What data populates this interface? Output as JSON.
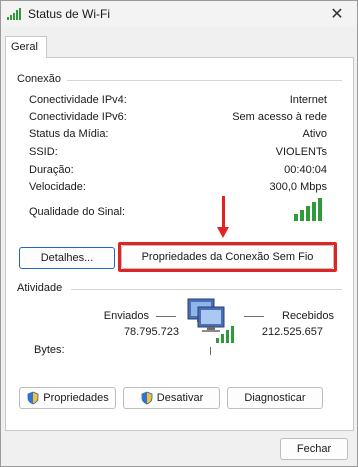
{
  "window": {
    "title": "Status de Wi-Fi",
    "close_glyph": "✕"
  },
  "tabs": [
    {
      "label": "Geral"
    }
  ],
  "connection": {
    "section_label": "Conexão",
    "rows": [
      {
        "label": "Conectividade IPv4:",
        "value": "Internet"
      },
      {
        "label": "Conectividade IPv6:",
        "value": "Sem acesso à rede"
      },
      {
        "label": "Status da Mídia:",
        "value": "Ativo"
      },
      {
        "label": "SSID:",
        "value": "VIOLENTs"
      },
      {
        "label": "Duração:",
        "value": "00:40:04"
      },
      {
        "label": "Velocidade:",
        "value": "300,0 Mbps"
      }
    ],
    "signal_label": "Qualidade do Sinal:",
    "signal_bars": 5,
    "signal_color": "#2e9a3a"
  },
  "buttons": {
    "details": "Detalhes...",
    "wireless_properties": "Propriedades da Conexão Sem Fio",
    "properties": "Propriedades",
    "disable": "Desativar",
    "diagnose": "Diagnosticar",
    "close": "Fechar"
  },
  "activity": {
    "section_label": "Atividade",
    "sent_label": "Enviados",
    "received_label": "Recebidos",
    "sent_value": "78.795.723",
    "received_value": "212.525.657",
    "bytes_label": "Bytes:"
  },
  "annotation": {
    "color": "#e02323"
  },
  "icons": {
    "title": "wifi-signal-icon",
    "network": "network-computers-icon",
    "shield": "uac-shield-icon"
  }
}
